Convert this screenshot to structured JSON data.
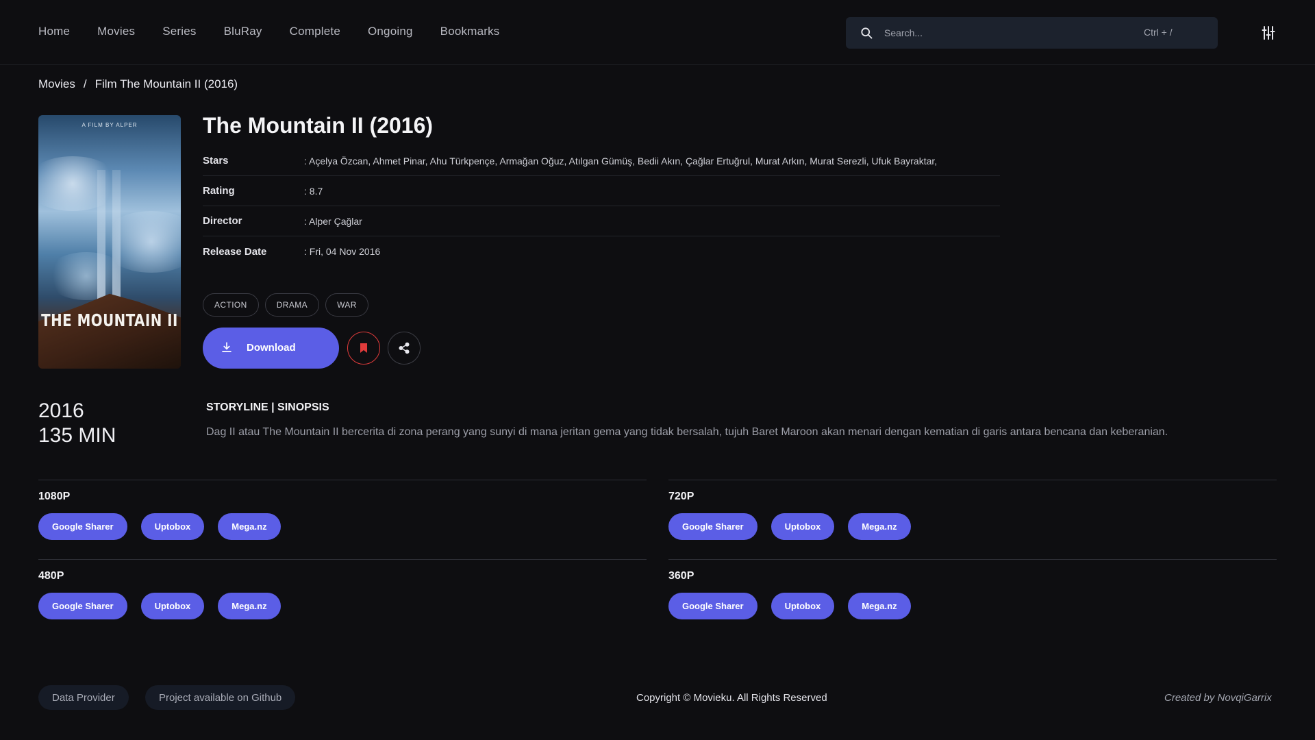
{
  "nav": {
    "items": [
      "Home",
      "Movies",
      "Series",
      "BluRay",
      "Complete",
      "Ongoing",
      "Bookmarks"
    ]
  },
  "search": {
    "placeholder": "Search...",
    "shortcut": "Ctrl + /",
    "icon": "search-icon"
  },
  "header": {
    "filter_icon": "sliders-icon"
  },
  "breadcrumb": {
    "root": "Movies",
    "separator": "/",
    "current": "Film The Mountain II (2016)"
  },
  "movie": {
    "title": "The Mountain II (2016)",
    "poster_title": "THE MOUNTAIN II",
    "poster_tagline": "A FILM BY ALPER",
    "info": [
      {
        "label": "Stars",
        "value": ": Açelya Özcan,  Ahmet Pinar,  Ahu Türkpençe,  Armağan Oğuz,  Atılgan Gümüş,  Bedii Akın,  Çağlar Ertuğrul,  Murat Arkın,  Murat Serezli,  Ufuk Bayraktar,"
      },
      {
        "label": "Rating",
        "value": ": 8.7"
      },
      {
        "label": "Director",
        "value": ": Alper Çağlar"
      },
      {
        "label": "Release Date",
        "value": ": Fri, 04 Nov 2016"
      }
    ],
    "genres": [
      "ACTION",
      "DRAMA",
      "WAR"
    ],
    "year": "2016",
    "duration": "135 MIN"
  },
  "actions": {
    "download_label": "Download",
    "download_icon": "download-icon",
    "bookmark_icon": "bookmark-icon",
    "share_icon": "share-icon"
  },
  "storyline": {
    "title": "STORYLINE | SINOPSIS",
    "text": "Dag II atau The Mountain II bercerita di zona perang yang sunyi di mana jeritan gema yang tidak bersalah, tujuh Baret Maroon akan menari dengan kematian di garis antara bencana dan keberanian."
  },
  "downloads": [
    {
      "quality": "1080P",
      "links": [
        "Google Sharer",
        "Uptobox",
        "Mega.nz"
      ]
    },
    {
      "quality": "720P",
      "links": [
        "Google Sharer",
        "Uptobox",
        "Mega.nz"
      ]
    },
    {
      "quality": "480P",
      "links": [
        "Google Sharer",
        "Uptobox",
        "Mega.nz"
      ]
    },
    {
      "quality": "360P",
      "links": [
        "Google Sharer",
        "Uptobox",
        "Mega.nz"
      ]
    }
  ],
  "footer": {
    "data_provider": "Data Provider",
    "github": "Project available on Github",
    "copyright": "Copyright © Movieku. All Rights Reserved",
    "created_by": "Created by NovqiGarrix"
  },
  "colors": {
    "background": "#0e0e11",
    "accent": "#5b5ee6",
    "bookmark": "#e03b3b",
    "search_bg": "#1c222d"
  }
}
